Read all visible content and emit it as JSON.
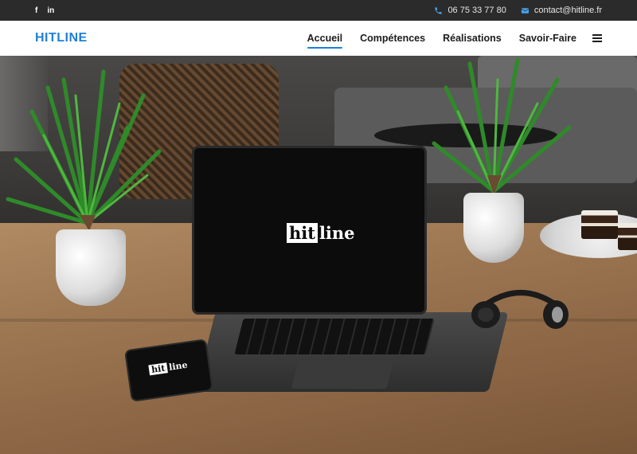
{
  "topbar": {
    "social": [
      {
        "icon": "facebook-icon",
        "label": "f"
      },
      {
        "icon": "linkedin-icon",
        "label": "in"
      }
    ],
    "phone": "06 75 33 77 80",
    "email": "contact@hitline.fr"
  },
  "navbar": {
    "brand": "HITLINE",
    "items": [
      {
        "label": "Accueil",
        "active": true
      },
      {
        "label": "Compétences",
        "active": false
      },
      {
        "label": "Réalisations",
        "active": false
      },
      {
        "label": "Savoir-Faire",
        "active": false
      }
    ]
  },
  "hero": {
    "logo_hit": "hit",
    "logo_line": "line",
    "phone_logo_hit": "hit",
    "phone_logo_line": "line"
  },
  "colors": {
    "brand": "#1f7fd8",
    "topbar_bg": "#2b2b2b"
  }
}
